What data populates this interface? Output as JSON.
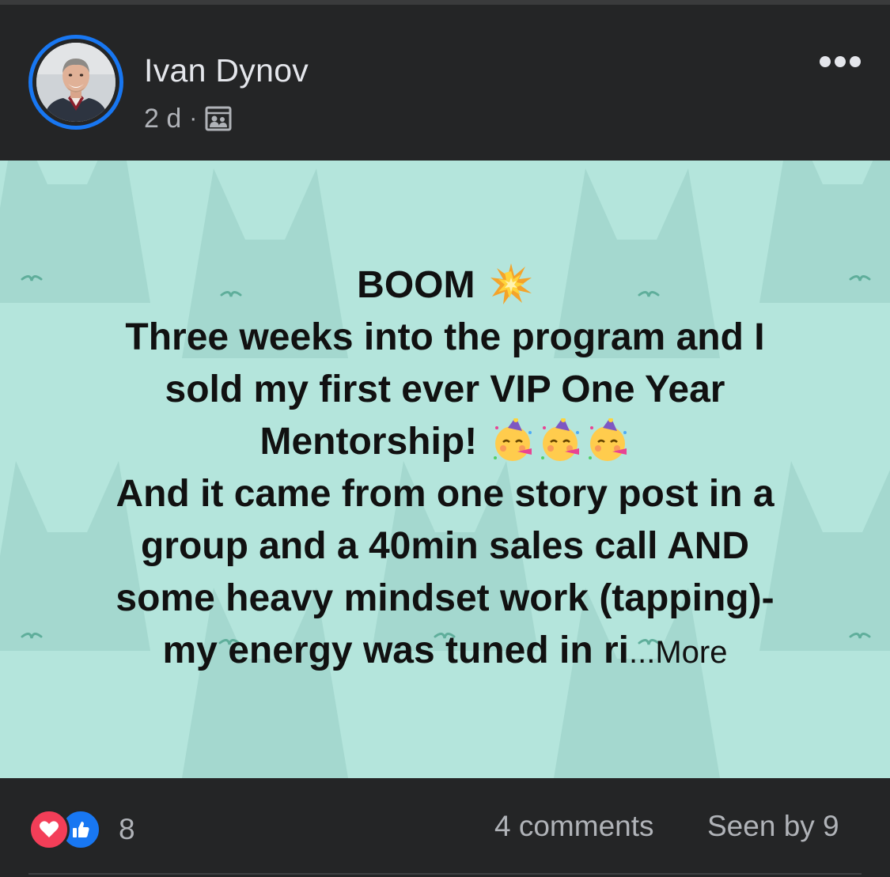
{
  "post": {
    "author_name": "Ivan Dynov",
    "timestamp": "2 d",
    "separator": "·",
    "audience_icon": "group-icon",
    "options_icon": "more-options-icon",
    "body_lines": [
      "BOOM",
      "Three weeks into the program and I",
      "sold my first ever VIP One Year",
      "Mentorship!",
      "And it came from one story post in a",
      "group and a 40min sales call AND",
      "some heavy mindset work (tapping)-",
      "my energy was tuned in ri"
    ],
    "see_more_label": "...More",
    "background_color": "#b4e5dc",
    "body_emojis": [
      "collision-emoji",
      "partying-face-emoji"
    ]
  },
  "footer": {
    "reaction_icons": [
      "love-reaction-icon",
      "like-reaction-icon"
    ],
    "reaction_count": "8",
    "comments_label": "4 comments",
    "seen_label": "Seen by 9"
  },
  "colors": {
    "accent": "#1877f2",
    "love": "#f33e58",
    "surface": "#242526",
    "text_primary": "#e4e6eb",
    "text_secondary": "#b0b3b8"
  }
}
